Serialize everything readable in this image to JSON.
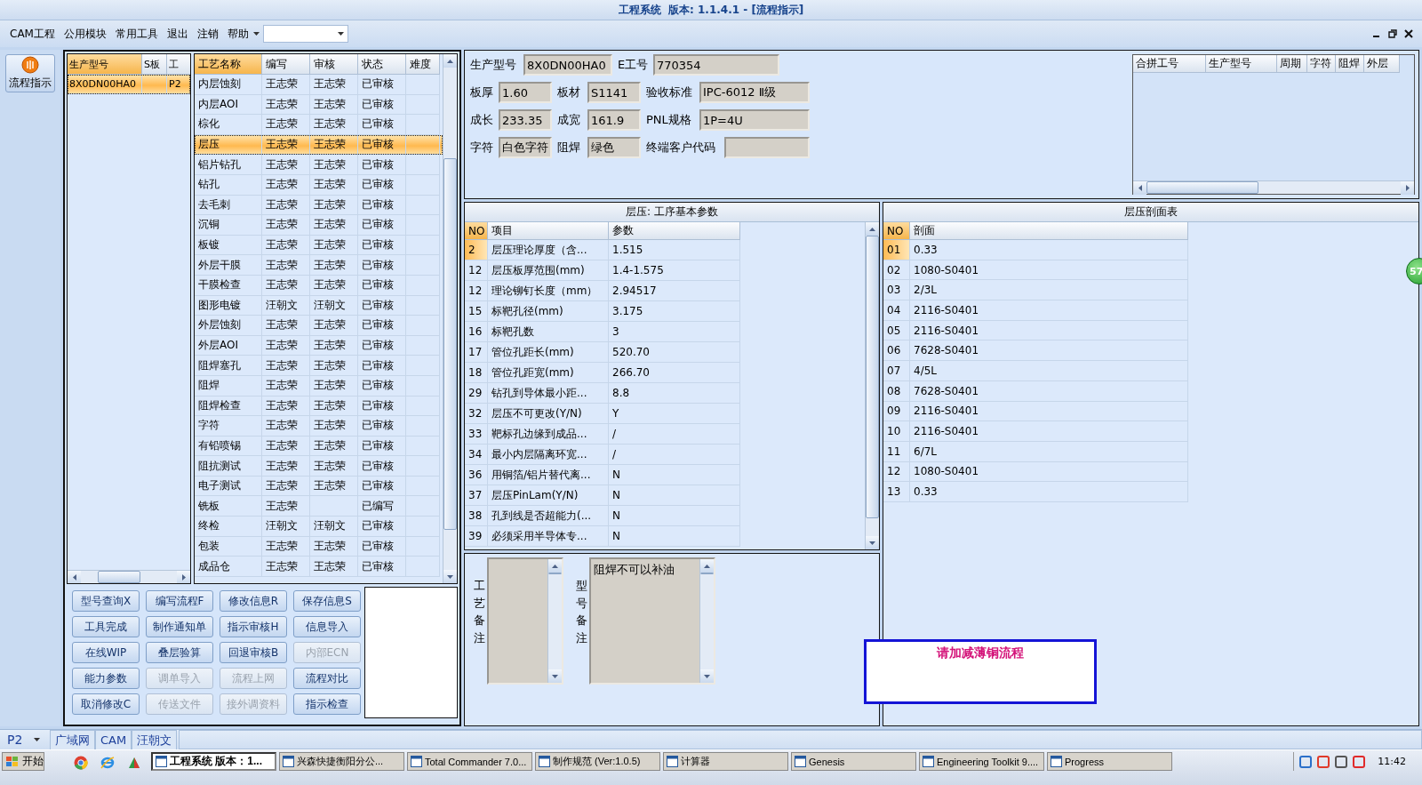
{
  "window": {
    "title": "工程系统  版本: 1.1.4.1 - [流程指示]"
  },
  "menu": [
    {
      "label": "CAM工程"
    },
    {
      "label": "公用模块"
    },
    {
      "label": "常用工具"
    },
    {
      "label": "退出"
    },
    {
      "label": "注销"
    },
    {
      "label": "帮助"
    }
  ],
  "sidebar": {
    "button": "流程指示",
    "selected": true
  },
  "model_table": {
    "columns": [
      "生产型号",
      "S板",
      "工"
    ],
    "rows": [
      {
        "cells": [
          "8X0DN00HA0",
          null,
          "P2"
        ],
        "selected": true
      }
    ]
  },
  "process_table": {
    "columns": [
      "工艺名称",
      "编写",
      "审核",
      "状态",
      "难度"
    ],
    "rows": [
      {
        "cells": [
          "内层蚀刻",
          "王志荣",
          "王志荣",
          "已审核"
        ],
        "selected": false
      },
      {
        "cells": [
          "内层AOI",
          "王志荣",
          "王志荣",
          "已审核"
        ],
        "selected": false
      },
      {
        "cells": [
          "棕化",
          "王志荣",
          "王志荣",
          "已审核"
        ],
        "selected": false
      },
      {
        "cells": [
          "层压",
          "王志荣",
          "王志荣",
          "已审核"
        ],
        "selected": true
      },
      {
        "cells": [
          "铝片钻孔",
          "王志荣",
          "王志荣",
          "已审核"
        ],
        "selected": false
      },
      {
        "cells": [
          "钻孔",
          "王志荣",
          "王志荣",
          "已审核"
        ],
        "selected": false
      },
      {
        "cells": [
          "去毛刺",
          "王志荣",
          "王志荣",
          "已审核"
        ],
        "selected": false
      },
      {
        "cells": [
          "沉铜",
          "王志荣",
          "王志荣",
          "已审核"
        ],
        "selected": false
      },
      {
        "cells": [
          "板镀",
          "王志荣",
          "王志荣",
          "已审核"
        ],
        "selected": false
      },
      {
        "cells": [
          "外层干膜",
          "王志荣",
          "王志荣",
          "已审核"
        ],
        "selected": false
      },
      {
        "cells": [
          "干膜检查",
          "王志荣",
          "王志荣",
          "已审核"
        ],
        "selected": false
      },
      {
        "cells": [
          "图形电镀",
          "汪朝文",
          "汪朝文",
          "已审核"
        ],
        "selected": false
      },
      {
        "cells": [
          "外层蚀刻",
          "王志荣",
          "王志荣",
          "已审核"
        ],
        "selected": false
      },
      {
        "cells": [
          "外层AOI",
          "王志荣",
          "王志荣",
          "已审核"
        ],
        "selected": false
      },
      {
        "cells": [
          "阻焊塞孔",
          "王志荣",
          "王志荣",
          "已审核"
        ],
        "selected": false
      },
      {
        "cells": [
          "阻焊",
          "王志荣",
          "王志荣",
          "已审核"
        ],
        "selected": false
      },
      {
        "cells": [
          "阻焊检查",
          "王志荣",
          "王志荣",
          "已审核"
        ],
        "selected": false
      },
      {
        "cells": [
          "字符",
          "王志荣",
          "王志荣",
          "已审核"
        ],
        "selected": false
      },
      {
        "cells": [
          "有铅喷锡",
          "王志荣",
          "王志荣",
          "已审核"
        ],
        "selected": false
      },
      {
        "cells": [
          "阻抗测试",
          "王志荣",
          "王志荣",
          "已审核"
        ],
        "selected": false
      },
      {
        "cells": [
          "电子测试",
          "王志荣",
          "王志荣",
          "已审核"
        ],
        "selected": false
      },
      {
        "cells": [
          "铣板",
          "王志荣",
          null,
          "已编写"
        ],
        "selected": false
      },
      {
        "cells": [
          "终检",
          "汪朝文",
          "汪朝文",
          "已审核"
        ],
        "selected": false
      },
      {
        "cells": [
          "包装",
          "王志荣",
          "王志荣",
          "已审核"
        ],
        "selected": false
      },
      {
        "cells": [
          "成品仓",
          "王志荣",
          "王志荣",
          "已审核"
        ],
        "selected": false
      }
    ]
  },
  "buttons": [
    {
      "label": "型号查询X",
      "disabled": false
    },
    {
      "label": "编写流程F",
      "disabled": false
    },
    {
      "label": "修改信息R",
      "disabled": false
    },
    {
      "label": "保存信息S",
      "disabled": false
    },
    {
      "label": "工具完成",
      "disabled": false
    },
    {
      "label": "制作通知单",
      "disabled": false
    },
    {
      "label": "指示审核H",
      "disabled": false
    },
    {
      "label": "信息导入",
      "disabled": false
    },
    {
      "label": "在线WIP",
      "disabled": false
    },
    {
      "label": "叠层验算",
      "disabled": false
    },
    {
      "label": "回退审核B",
      "disabled": false
    },
    {
      "label": "内部ECN",
      "disabled": true
    },
    {
      "label": "能力参数",
      "disabled": false
    },
    {
      "label": "调单导入",
      "disabled": true
    },
    {
      "label": "流程上网",
      "disabled": true
    },
    {
      "label": "流程对比",
      "disabled": false
    },
    {
      "label": "取消修改C",
      "disabled": false
    },
    {
      "label": "传送文件",
      "disabled": true
    },
    {
      "label": "接外调资料",
      "disabled": true
    },
    {
      "label": "指示检查",
      "disabled": false
    }
  ],
  "info_fields": [
    [
      {
        "label": "生产型号",
        "value": "8X0DN00HA0"
      },
      {
        "label": "E工号",
        "value": "770354"
      }
    ],
    [
      {
        "label": "板厚",
        "value": "1.60"
      },
      {
        "label": "板材",
        "value": "S1141"
      },
      {
        "label": "验收标准",
        "value": "IPC-6012 Ⅱ级"
      }
    ],
    [
      {
        "label": "成长",
        "value": "233.35"
      },
      {
        "label": "成宽",
        "value": "161.9"
      },
      {
        "label": "PNL规格",
        "value": "1P=4U"
      }
    ],
    [
      {
        "label": "字符",
        "value": "白色字符"
      },
      {
        "label": "阻焊",
        "value": "绿色"
      },
      {
        "label": "终端客户代码"
      }
    ]
  ],
  "combined_table": {
    "columns": [
      "合拼工号",
      "生产型号",
      "周期",
      "字符",
      "阻焊",
      "外层"
    ]
  },
  "params_table": {
    "title": "层压: 工序基本参数",
    "columns": [
      "NO",
      "项目",
      "参数"
    ],
    "rows": [
      {
        "cells": [
          "2",
          "层压理论厚度（含...",
          "1.515"
        ],
        "selected": true
      },
      {
        "cells": [
          "12",
          "层压板厚范围(mm)",
          "1.4-1.575"
        ],
        "selected": false
      },
      {
        "cells": [
          "12",
          "理论铆钉长度（mm）",
          "2.94517"
        ],
        "selected": false
      },
      {
        "cells": [
          "15",
          "标靶孔径(mm)",
          "3.175"
        ],
        "selected": false
      },
      {
        "cells": [
          "16",
          "标靶孔数",
          "3"
        ],
        "selected": false
      },
      {
        "cells": [
          "17",
          "管位孔距长(mm)",
          "520.70"
        ],
        "selected": false
      },
      {
        "cells": [
          "18",
          "管位孔距宽(mm)",
          "266.70"
        ],
        "selected": false
      },
      {
        "cells": [
          "29",
          "钻孔到导体最小距...",
          "8.8"
        ],
        "selected": false
      },
      {
        "cells": [
          "32",
          "层压不可更改(Y/N)",
          "Y"
        ],
        "selected": false
      },
      {
        "cells": [
          "33",
          "靶标孔边缘到成品...",
          "/"
        ],
        "selected": false
      },
      {
        "cells": [
          "34",
          "最小内层隔离环宽...",
          "/"
        ],
        "selected": false
      },
      {
        "cells": [
          "36",
          "用铜箔/铝片替代离...",
          "N"
        ],
        "selected": false
      },
      {
        "cells": [
          "37",
          "层压PinLam(Y/N)",
          "N"
        ],
        "selected": false
      },
      {
        "cells": [
          "38",
          "孔到线是否超能力(...",
          "N"
        ],
        "selected": false
      },
      {
        "cells": [
          "39",
          "必须采用半导体专...",
          "N"
        ],
        "selected": false
      }
    ]
  },
  "stackup_table": {
    "title": "层压剖面表",
    "columns": [
      "NO",
      "剖面"
    ],
    "rows": [
      {
        "cells": [
          "01",
          "0.33"
        ],
        "selected": true
      },
      {
        "cells": [
          "02",
          "1080-S0401"
        ],
        "selected": false
      },
      {
        "cells": [
          "03",
          "2/3L"
        ],
        "selected": false
      },
      {
        "cells": [
          "04",
          "2116-S0401"
        ],
        "selected": false
      },
      {
        "cells": [
          "05",
          "2116-S0401"
        ],
        "selected": false
      },
      {
        "cells": [
          "06",
          "7628-S0401"
        ],
        "selected": false
      },
      {
        "cells": [
          "07",
          "4/5L"
        ],
        "selected": false
      },
      {
        "cells": [
          "08",
          "7628-S0401"
        ],
        "selected": false
      },
      {
        "cells": [
          "09",
          "2116-S0401"
        ],
        "selected": false
      },
      {
        "cells": [
          "10",
          "2116-S0401"
        ],
        "selected": false
      },
      {
        "cells": [
          "11",
          "6/7L"
        ],
        "selected": false
      },
      {
        "cells": [
          "12",
          "1080-S0401"
        ],
        "selected": false
      },
      {
        "cells": [
          "13",
          "0.33"
        ],
        "selected": false
      }
    ]
  },
  "remarks": [
    {
      "label": "工艺备注"
    },
    {
      "label": "型号备注",
      "value": "阻焊不可以补油"
    }
  ],
  "notice": "请加减薄铜流程",
  "badge": "57",
  "status_bar": {
    "server": "P2",
    "tabs": [
      "广域网",
      "CAM",
      "汪朝文"
    ]
  },
  "taskbar": {
    "start": "开始",
    "tasks": [
      {
        "label": "工程系统  版本：1...",
        "selected": true
      },
      {
        "label": "兴森快捷衡阳分公...",
        "selected": false
      },
      {
        "label": "Total Commander 7.0...",
        "selected": false
      },
      {
        "label": "制作规范 (Ver:1.0.5)",
        "selected": false
      },
      {
        "label": "计算器",
        "selected": false
      },
      {
        "label": "Genesis",
        "selected": false
      },
      {
        "label": "Engineering Toolkit 9....",
        "selected": false
      },
      {
        "label": "Progress",
        "selected": false
      }
    ],
    "clock": "11:42"
  }
}
